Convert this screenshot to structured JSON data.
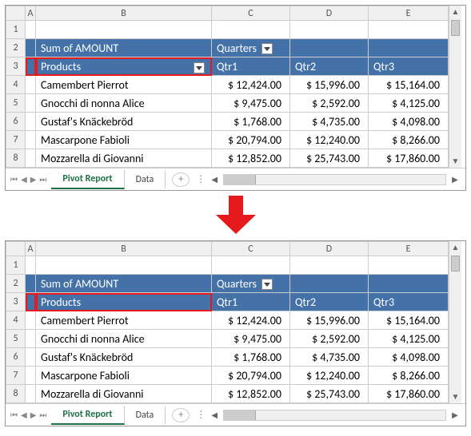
{
  "columns": {
    "A": "A",
    "B": "B",
    "C": "C",
    "D": "D",
    "E": "E"
  },
  "rownums": {
    "r1": "1",
    "r2": "2",
    "r3": "3",
    "r4": "4",
    "r5": "5",
    "r6": "6",
    "r7": "7",
    "r8": "8"
  },
  "pivot": {
    "sum_label": "Sum of AMOUNT",
    "quarters_label": "Quarters",
    "products_label": "Products",
    "qtr_headers": {
      "q1": "Qtr1",
      "q2": "Qtr2",
      "q3": "Qtr3"
    },
    "rows": [
      {
        "product": "Camembert Pierrot",
        "q1": "$ 12,424.00",
        "q2": "$ 15,996.00",
        "q3": "$ 15,164.00"
      },
      {
        "product": "Gnocchi di nonna Alice",
        "q1": "$ 9,475.00",
        "q2": "$ 2,592.00",
        "q3": "$ 4,125.00"
      },
      {
        "product": "Gustaf's Knäckebröd",
        "q1": "$ 1,768.00",
        "q2": "$ 4,735.00",
        "q3": "$ 4,098.00"
      },
      {
        "product": "Mascarpone Fabioli",
        "q1": "$ 20,794.00",
        "q2": "$ 12,240.00",
        "q3": "$ 8,266.00"
      },
      {
        "product": "Mozzarella di Giovanni",
        "q1": "$ 12,852.00",
        "q2": "$ 25,743.00",
        "q3": "$ 17,860.00"
      }
    ]
  },
  "tabs": {
    "active": "Pivot Report",
    "other": "Data"
  },
  "panel1_products_has_filter": true,
  "panel2_products_has_filter": false
}
